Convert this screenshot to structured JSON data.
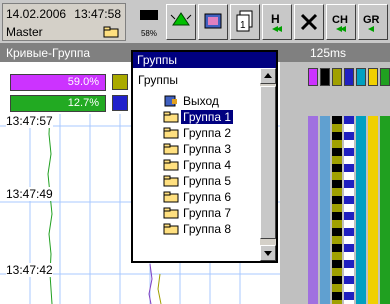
{
  "status": {
    "date": "14.02.2006",
    "time": "13:47:58",
    "role": "Master",
    "cpu_percent": "58%"
  },
  "toolbar": {
    "icons": [
      "cpu-meter-icon",
      "alarm-icon",
      "monitor-icon",
      "pages-icon",
      "hold-icon",
      "tools-icon",
      "ch-icon",
      "grp-icon"
    ],
    "ch_label": "CH",
    "grp_label": "GR"
  },
  "left_panel": {
    "title": "Кривые-Группа",
    "values": [
      {
        "text": "59.0%",
        "color": "#cc33ff"
      },
      {
        "text": "12.7%",
        "color": "#22aa22"
      }
    ],
    "swatches": [
      "#aaaa00",
      "#2222cc"
    ],
    "time_labels": [
      "13:47:57",
      "13:47:49",
      "13:47:42"
    ]
  },
  "right_panel": {
    "interval": "125ms"
  },
  "dropdown": {
    "title": "Группы",
    "header": "Группы",
    "items": [
      {
        "label": "Выход",
        "icon": "exit-icon",
        "selected": false
      },
      {
        "label": "Группа 1",
        "icon": "folder-icon",
        "selected": true
      },
      {
        "label": "Группа 2",
        "icon": "folder-icon",
        "selected": false
      },
      {
        "label": "Группа 3",
        "icon": "folder-icon",
        "selected": false
      },
      {
        "label": "Группа 4",
        "icon": "folder-icon",
        "selected": false
      },
      {
        "label": "Группа 5",
        "icon": "folder-icon",
        "selected": false
      },
      {
        "label": "Группа 6",
        "icon": "folder-icon",
        "selected": false
      },
      {
        "label": "Группа 7",
        "icon": "folder-icon",
        "selected": false
      },
      {
        "label": "Группа 8",
        "icon": "folder-icon",
        "selected": false
      }
    ]
  }
}
